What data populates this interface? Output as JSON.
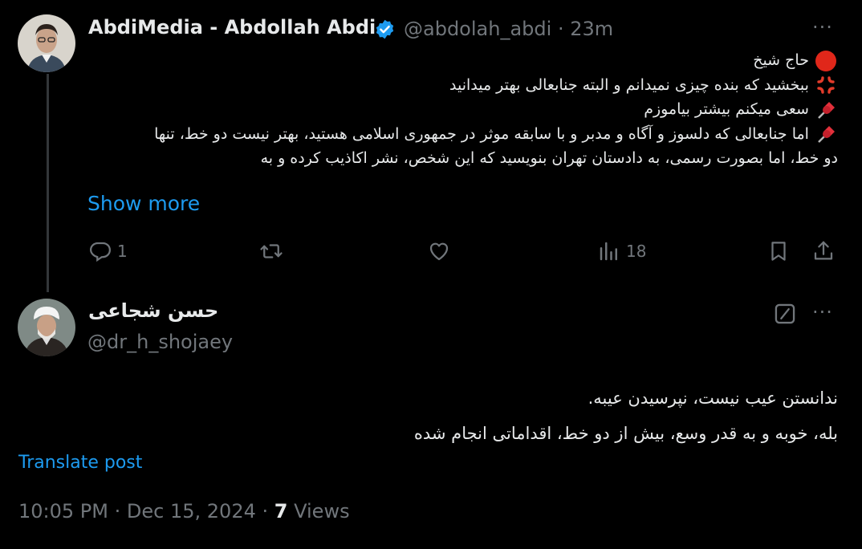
{
  "parent_post": {
    "display_name": "AbdiMedia - Abdollah Abdi",
    "handle": "@abdolah_abdi",
    "time_ago": "· 23m",
    "more_label": "···",
    "lines": [
      "حاج شیخ",
      "ببخشید که بنده چیزی نمیدانم و البته جنابعالی بهتر میدانید",
      "سعی میکنم بیشتر بیاموزم",
      "اما جنابعالی که دلسوز و آگاه و مدبر و با سابقه موثر در جمهوری اسلامی هستید، بهتر نیست دو خط، تنها",
      "دو خط، اما بصورت رسمی، به دادستان تهران بنویسید که این شخص، نشر اکاذیب کرده و به"
    ],
    "line_icons": [
      "red-circle-icon",
      "angry-symbol-icon",
      "pushpin-icon",
      "pushpin-icon",
      ""
    ],
    "show_more": "Show more",
    "actions": {
      "reply_count": "1",
      "views_count": "18"
    }
  },
  "main_post": {
    "display_name": "حسن شجاعی",
    "handle": "@dr_h_shojaey",
    "more_label": "···",
    "lines": [
      "ندانستن عیب نیست، نپرسیدن عیبه.",
      "بله، خوبه و به قدر وسع، بیش از دو خط، اقداماتی انجام شده"
    ],
    "translate": "Translate post",
    "meta": {
      "time": "10:05 PM",
      "sep1": "·",
      "date": "Dec 15, 2024",
      "sep2": "·",
      "views_count": "7",
      "views_label": "Views"
    }
  },
  "colors": {
    "background": "#000000",
    "text": "#e7e9ea",
    "muted": "#71767b",
    "link": "#1d9bf0",
    "verified": "#1d9bf0"
  }
}
